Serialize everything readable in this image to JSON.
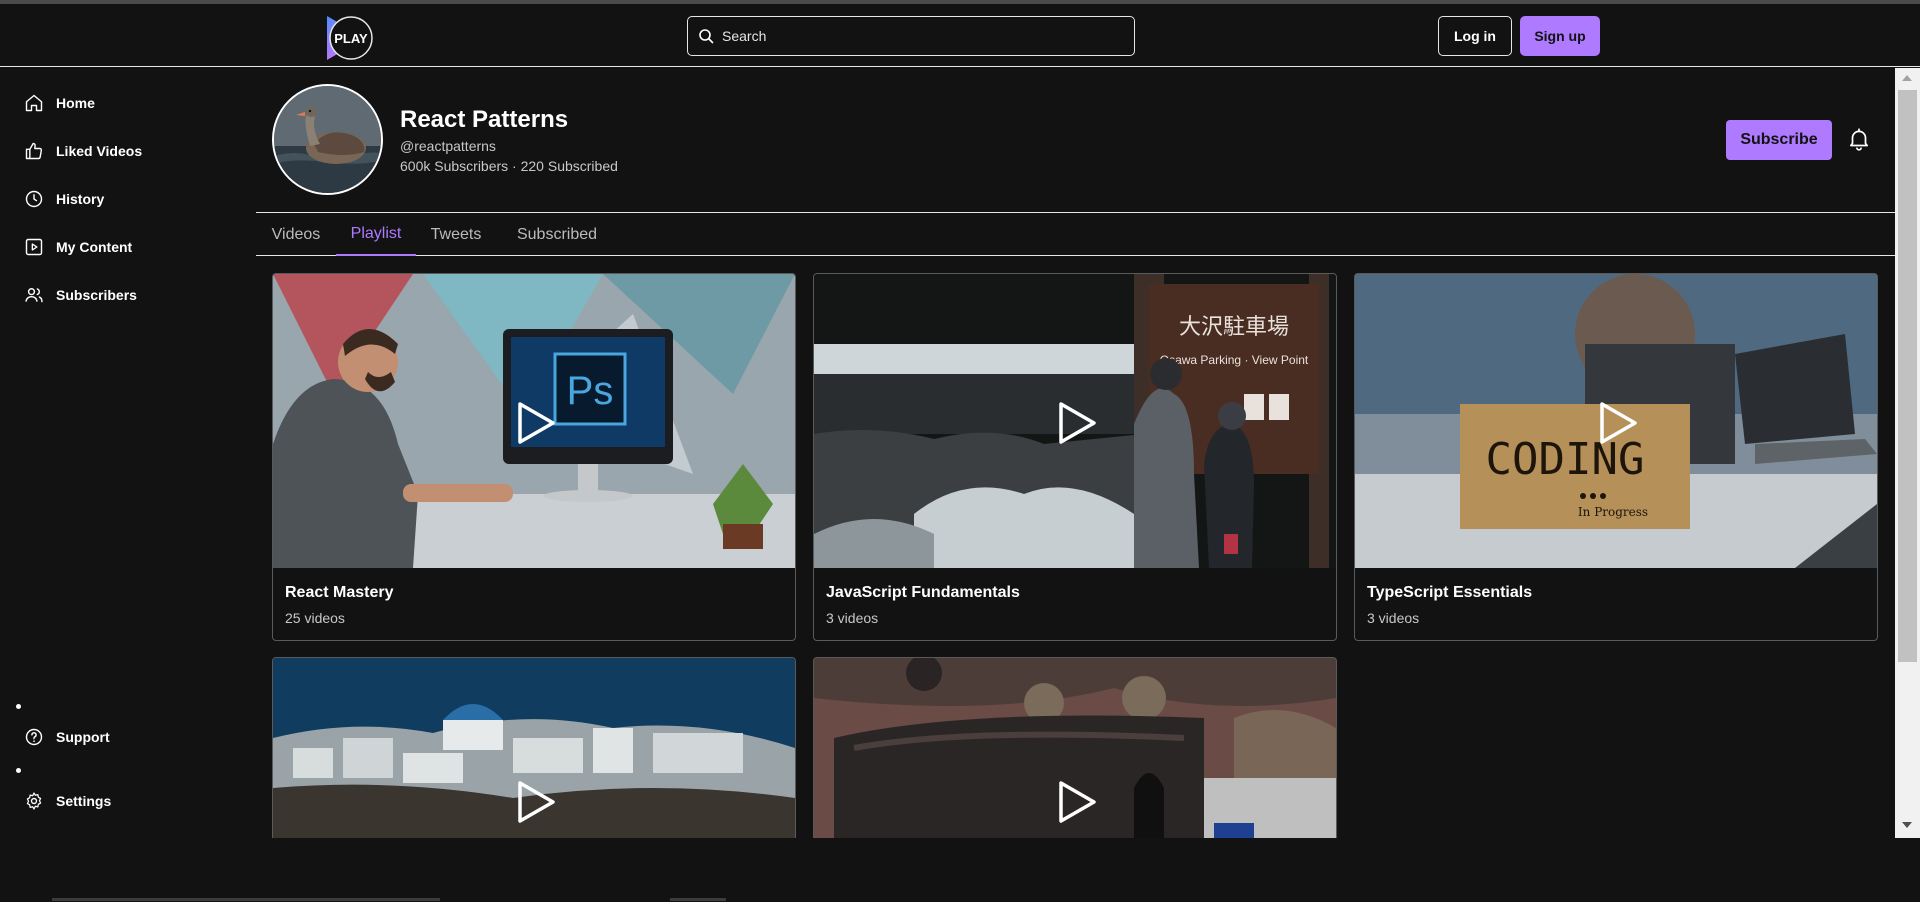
{
  "header": {
    "logo_text": "PLAY",
    "search_placeholder": "Search",
    "login_label": "Log in",
    "signup_label": "Sign up"
  },
  "sidebar": {
    "items": [
      {
        "label": "Home",
        "icon": "home-icon"
      },
      {
        "label": "Liked Videos",
        "icon": "thumbs-up-icon"
      },
      {
        "label": "History",
        "icon": "clock-icon"
      },
      {
        "label": "My Content",
        "icon": "video-icon"
      },
      {
        "label": "Subscribers",
        "icon": "users-icon"
      }
    ],
    "bottom_items": [
      {
        "label": "Support",
        "icon": "help-circle-icon"
      },
      {
        "label": "Settings",
        "icon": "gear-icon"
      }
    ]
  },
  "channel": {
    "name": "React Patterns",
    "handle": "@reactpatterns",
    "stats": "600k Subscribers · 220 Subscribed",
    "subscribe_label": "Subscribe"
  },
  "tabs": [
    {
      "label": "Videos",
      "active": false
    },
    {
      "label": "Playlist",
      "active": true
    },
    {
      "label": "Tweets",
      "active": false
    },
    {
      "label": "Subscribed",
      "active": false
    }
  ],
  "playlists": [
    {
      "title": "React Mastery",
      "count": "25 videos"
    },
    {
      "title": "JavaScript Fundamentals",
      "count": "3 videos"
    },
    {
      "title": "TypeScript Essentials",
      "count": "3 videos"
    },
    {
      "title": "",
      "count": ""
    },
    {
      "title": "",
      "count": ""
    }
  ],
  "colors": {
    "accent": "#ae7aff",
    "background": "#121212",
    "border": "#e6e6e6"
  }
}
